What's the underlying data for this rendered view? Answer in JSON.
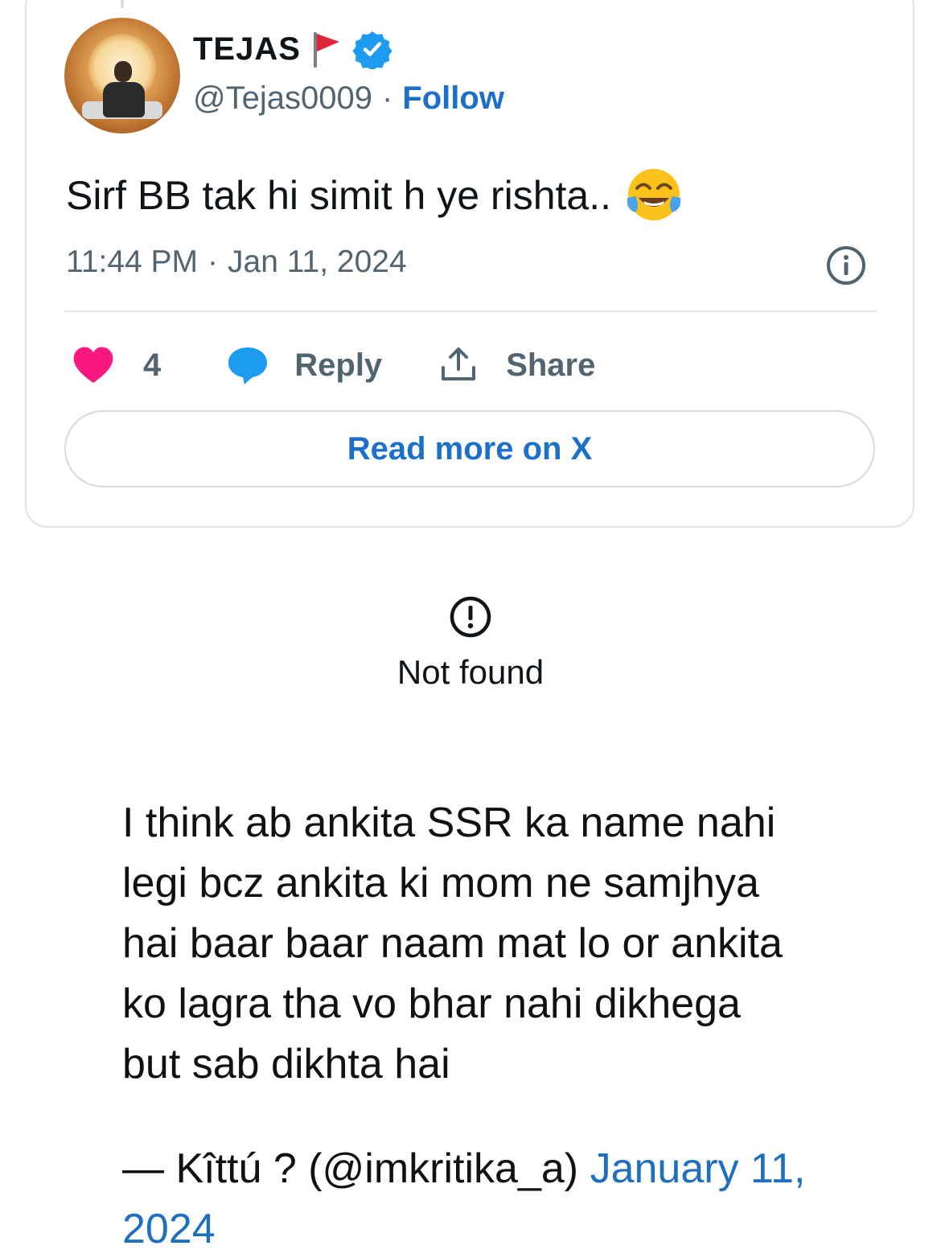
{
  "tweet": {
    "author_name": "TEJAS",
    "flag_icon": "red-flag-icon",
    "verified_icon": "verified-badge-icon",
    "handle": "@Tejas0009",
    "separator": "·",
    "follow_label": "Follow",
    "text": "Sirf BB tak hi simit h ye rishta..",
    "emoji_icon": "face-with-tears-of-joy-icon",
    "time": "11:44 PM",
    "date": "Jan 11, 2024",
    "likes": "4",
    "reply_label": "Reply",
    "share_label": "Share",
    "read_more_label": "Read more on X",
    "colors": {
      "link": "#1d70c9",
      "heart": "#f91880",
      "reply_bubble": "#1d9bf0",
      "muted": "#536471"
    }
  },
  "not_found": {
    "icon": "alert-circle-icon",
    "text": "Not found"
  },
  "quote": {
    "lines": [
      "I think ab ankita SSR ka name nahi",
      "legi bcz ankita ki mom ne samjhya",
      "hai baar baar naam mat lo or ankita",
      "ko lagra tha vo bhar nahi dikhega",
      "but sab dikhta hai"
    ],
    "attribution_prefix": "— Kîttú ? (@imkritika_a)",
    "attribution_link_line1": "January 11,",
    "attribution_link_line2": "2024"
  }
}
